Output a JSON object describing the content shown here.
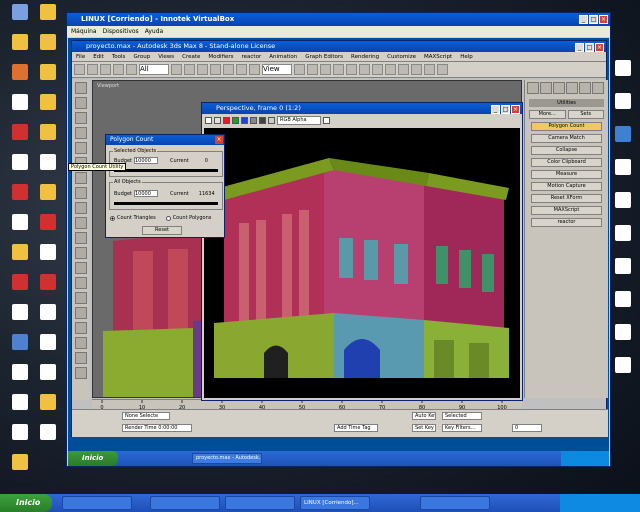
{
  "desktop": {
    "left_icons": [
      {
        "label": "",
        "color": "#7aa0e0"
      },
      {
        "label": "",
        "color": "#f0c040"
      },
      {
        "label": "",
        "color": "#e07030"
      },
      {
        "label": "",
        "color": "#ffffff"
      },
      {
        "label": "",
        "color": "#d03030"
      },
      {
        "label": "",
        "color": "#ffffff"
      },
      {
        "label": "",
        "color": "#d03030"
      },
      {
        "label": "",
        "color": "#ffffff"
      },
      {
        "label": "",
        "color": "#f0c040"
      },
      {
        "label": "",
        "color": "#d03030"
      },
      {
        "label": "",
        "color": "#ffffff"
      },
      {
        "label": "",
        "color": "#5080d0"
      },
      {
        "label": "",
        "color": "#ffffff"
      },
      {
        "label": "",
        "color": "#ffffff"
      },
      {
        "label": "",
        "color": "#ffffff"
      },
      {
        "label": "",
        "color": "#f0c040"
      }
    ],
    "col2_icons": [
      {
        "label": "",
        "color": "#f0c040"
      },
      {
        "label": "",
        "color": "#f0c040"
      },
      {
        "label": "",
        "color": "#f0c040"
      },
      {
        "label": "",
        "color": "#f0c040"
      },
      {
        "label": "",
        "color": "#f0c040"
      },
      {
        "label": "",
        "color": "#ffffff"
      },
      {
        "label": "",
        "color": "#f0c040"
      },
      {
        "label": "",
        "color": "#d03030"
      },
      {
        "label": "",
        "color": "#ffffff"
      },
      {
        "label": "",
        "color": "#d03030"
      },
      {
        "label": "",
        "color": "#ffffff"
      },
      {
        "label": "",
        "color": "#ffffff"
      },
      {
        "label": "",
        "color": "#ffffff"
      },
      {
        "label": "",
        "color": "#f0c040"
      },
      {
        "label": "",
        "color": "#ffffff"
      }
    ],
    "right_icons": [
      {
        "label": "",
        "color": "#ffffff"
      },
      {
        "label": "",
        "color": "#ffffff"
      },
      {
        "label": "",
        "color": "#4080d0"
      },
      {
        "label": "",
        "color": "#ffffff"
      },
      {
        "label": "",
        "color": "#ffffff"
      },
      {
        "label": "",
        "color": "#ffffff"
      },
      {
        "label": "",
        "color": "#ffffff"
      },
      {
        "label": "",
        "color": "#ffffff"
      },
      {
        "label": "",
        "color": "#ffffff"
      },
      {
        "label": "",
        "color": "#ffffff"
      }
    ]
  },
  "vbox": {
    "title": "LINUX [Corriendo] - Innotek VirtualBox",
    "menu": [
      "Máquina",
      "Dispositivos",
      "Ayuda"
    ]
  },
  "max": {
    "title": "proyecto.max - Autodesk 3ds Max 8 - Stand-alone License",
    "menu": [
      "File",
      "Edit",
      "Tools",
      "Group",
      "Views",
      "Create",
      "Modifiers",
      "reactor",
      "Animation",
      "Graph Editors",
      "Rendering",
      "Customize",
      "MAXScript",
      "Help"
    ],
    "toolbar_dropdown": "All",
    "view_dropdown": "View",
    "viewport_label": "Viewport",
    "time_slider": "0 / 100",
    "timeline_ticks": [
      "0",
      "10",
      "20",
      "30",
      "40",
      "50",
      "60",
      "70",
      "80",
      "90",
      "100"
    ],
    "status_fields": [
      "None Selecte",
      "Render Time 0:00:00",
      "Add Time Tag",
      "Auto Key",
      "Set Key",
      "Selected",
      "Key Filters...",
      "0"
    ]
  },
  "utilities": {
    "header": "Utilities",
    "tabs": [
      "More...",
      "Sets"
    ],
    "buttons": [
      "Polygon Count",
      "Camera Match",
      "Collapse",
      "Color Clipboard",
      "Measure",
      "Motion Capture",
      "Reset XForm",
      "MAXScript",
      "reactor"
    ]
  },
  "persp": {
    "title": "Perspective, frame 0 (1:2)",
    "channel": "RGB Alpha"
  },
  "poly": {
    "title": "Polygon Count",
    "selected_group": "Selected Objects",
    "budget_label": "Budget",
    "budget_value": "10000",
    "current_label": "Current",
    "current_sel_value": "0",
    "all_group": "All Objects",
    "current_all_value": "11634",
    "tooltip": "Polygon Count Utility",
    "radio_triangles": "Count Triangles",
    "radio_polygons": "Count Polygons",
    "reset_label": "Reset"
  },
  "guest_taskbar": {
    "start": "Inicio",
    "tasks": [
      "proyecto.max - Autodesk..."
    ],
    "clock": ""
  },
  "host_taskbar": {
    "start": "Inicio",
    "tasks": [
      "",
      "",
      "",
      "LINUX [Corriendo]...",
      ""
    ],
    "clock": ""
  }
}
